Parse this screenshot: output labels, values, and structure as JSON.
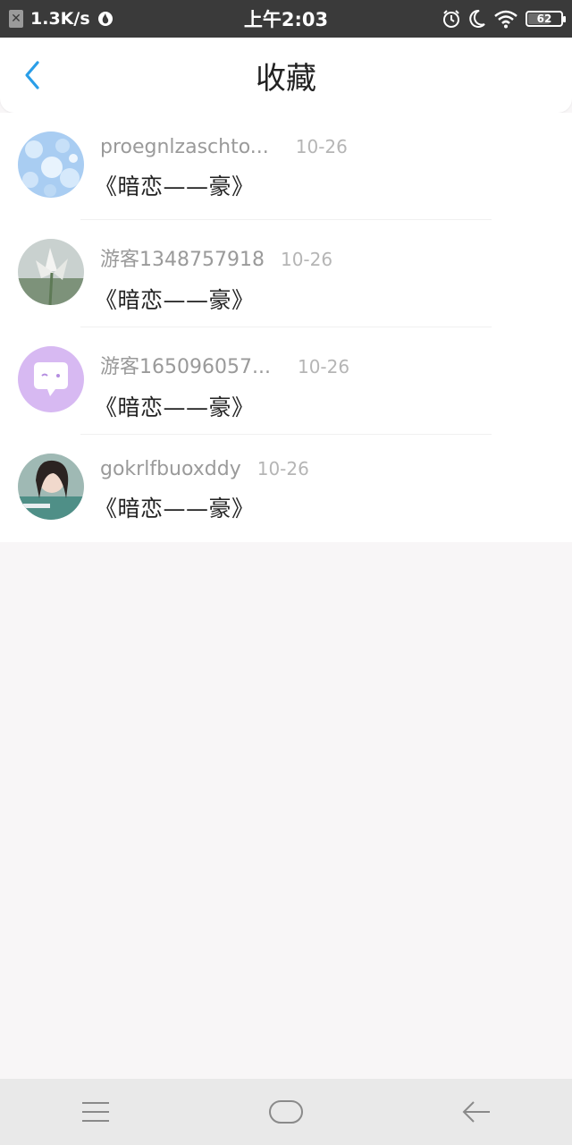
{
  "status_bar": {
    "net_speed": "1.3K/s",
    "time": "上午2:03",
    "battery": "62",
    "battery_level": 0.62
  },
  "header": {
    "title": "收藏"
  },
  "items": [
    {
      "username": "proegnlzaschto...",
      "date": "10-26",
      "title": "《暗恋——豪》"
    },
    {
      "username": "游客1348757918",
      "date": "10-26",
      "title": "《暗恋——豪》"
    },
    {
      "username": "游客165096057...",
      "date": "10-26",
      "title": "《暗恋——豪》"
    },
    {
      "username": "gokrlfbuoxddy",
      "date": "10-26",
      "title": "《暗恋——豪》"
    }
  ],
  "colors": {
    "accent": "#2a9ee8",
    "status_bar": "#3a3a3a",
    "background": "#f8f6f7"
  },
  "icons": [
    "close-box-icon",
    "flame-icon",
    "alarm-icon",
    "moon-icon",
    "wifi-icon",
    "battery-icon",
    "back-chevron-icon",
    "menu-icon",
    "home-icon",
    "back-arrow-icon"
  ]
}
